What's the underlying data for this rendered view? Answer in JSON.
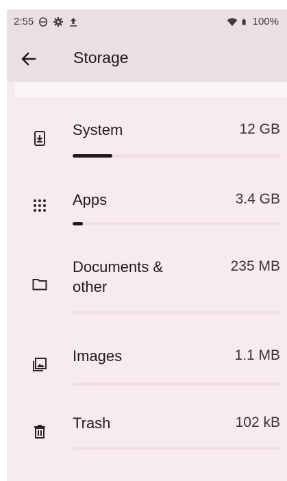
{
  "status_bar": {
    "time": "2:55",
    "battery": "100%",
    "icons": [
      "data-saver-icon",
      "gear-icon",
      "upload-icon",
      "wifi-icon",
      "battery-icon"
    ]
  },
  "app_bar": {
    "title": "Storage",
    "back_icon": "back-arrow-icon"
  },
  "categories": [
    {
      "label": "System",
      "value": "12 GB",
      "icon": "phone-download-icon",
      "fraction": 0.19
    },
    {
      "label": "Apps",
      "value": "3.4 GB",
      "icon": "grid-dots-icon",
      "fraction": 0.05
    },
    {
      "label": "Documents & other",
      "value": "235 MB",
      "icon": "folder-icon",
      "fraction": 0
    },
    {
      "label": "Images",
      "value": "1.1 MB",
      "icon": "images-icon",
      "fraction": 0
    },
    {
      "label": "Trash",
      "value": "102 kB",
      "icon": "trash-icon",
      "fraction": 0
    }
  ],
  "colors": {
    "background": "#f7ebf0",
    "app_bar": "#eadfe3",
    "bar_track": "#efe0e6",
    "bar_fill": "#1f1a1d"
  }
}
